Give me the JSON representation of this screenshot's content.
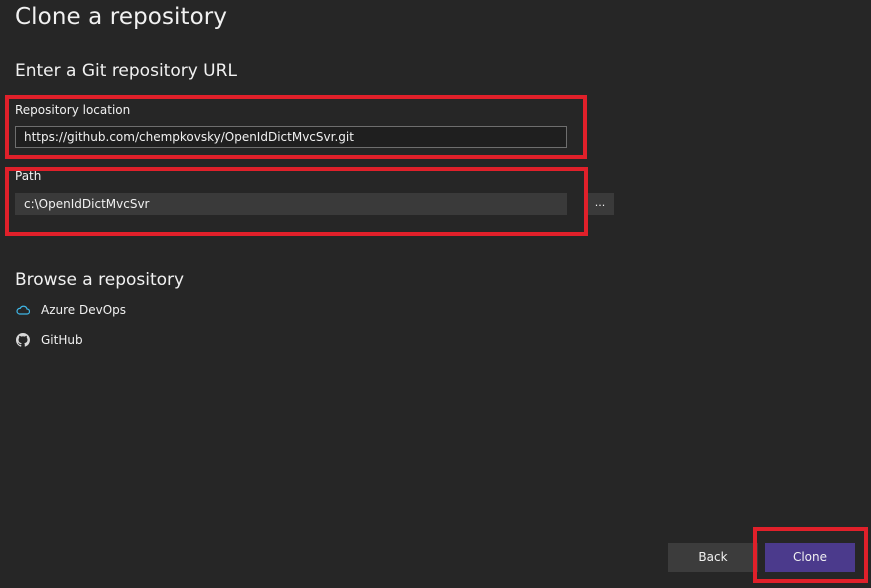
{
  "dialog": {
    "title": "Clone a repository"
  },
  "url_section": {
    "heading": "Enter a Git repository URL",
    "repository_location": {
      "label": "Repository location",
      "value": "https://github.com/chempkovsky/OpenIdDictMvcSvr.git"
    },
    "path": {
      "label": "Path",
      "value": "c:\\OpenIdDictMvcSvr",
      "browse_label": "..."
    }
  },
  "browse_section": {
    "heading": "Browse a repository",
    "providers": [
      {
        "label": "Azure DevOps",
        "icon": "cloud-icon"
      },
      {
        "label": "GitHub",
        "icon": "github-icon"
      }
    ]
  },
  "footer": {
    "back_label": "Back",
    "clone_label": "Clone"
  },
  "colors": {
    "background": "#262626",
    "highlight": "#e0202a",
    "primary_button": "#4b3a8c",
    "azure_icon": "#3fb6e6"
  }
}
